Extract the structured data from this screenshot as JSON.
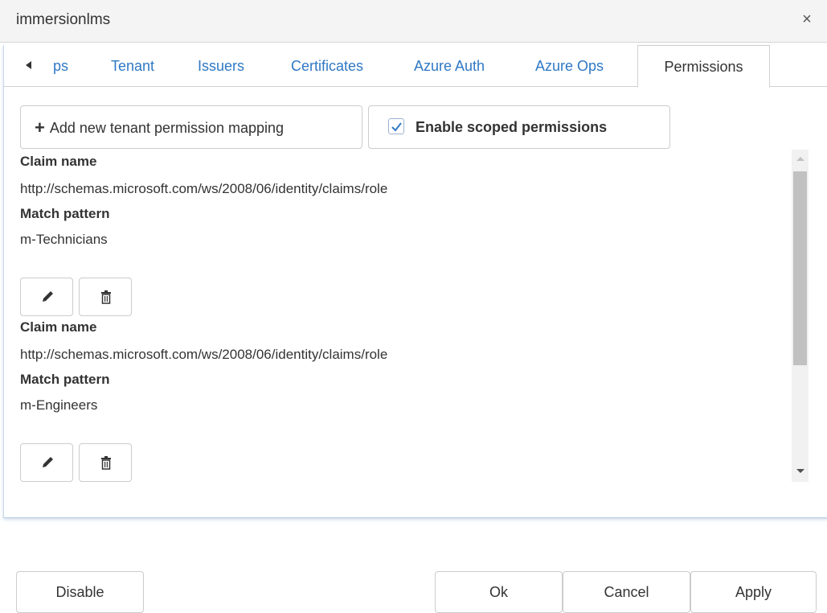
{
  "window": {
    "title": "immersionlms",
    "close_glyph": "×"
  },
  "tabs": [
    {
      "label": "ps"
    },
    {
      "label": "Tenant"
    },
    {
      "label": "Issuers"
    },
    {
      "label": "Certificates"
    },
    {
      "label": "Azure Auth"
    },
    {
      "label": "Azure Ops"
    },
    {
      "label": "Permissions",
      "active": true
    }
  ],
  "toolbar": {
    "add_icon": "+",
    "add_label": "Add new tenant permission mapping",
    "scoped_label": "Enable scoped permissions",
    "scoped_checked": true
  },
  "mappings": [
    {
      "claim_name_label": "Claim name",
      "claim_name": "http://schemas.microsoft.com/ws/2008/06/identity/claims/role",
      "match_pattern_label": "Match pattern",
      "match_pattern": "m-Technicians"
    },
    {
      "claim_name_label": "Claim name",
      "claim_name": "http://schemas.microsoft.com/ws/2008/06/identity/claims/role",
      "match_pattern_label": "Match pattern",
      "match_pattern": "m-Engineers"
    }
  ],
  "footer": {
    "disable_label": "Disable",
    "ok_label": "Ok",
    "cancel_label": "Cancel",
    "apply_label": "Apply"
  },
  "colors": {
    "link": "#2f78c4",
    "checkbox_check": "#2f78c4"
  },
  "icons": [
    "scroll-left-icon",
    "plus-icon",
    "checkbox-checked-icon",
    "pencil-icon",
    "trash-icon",
    "close-icon"
  ]
}
